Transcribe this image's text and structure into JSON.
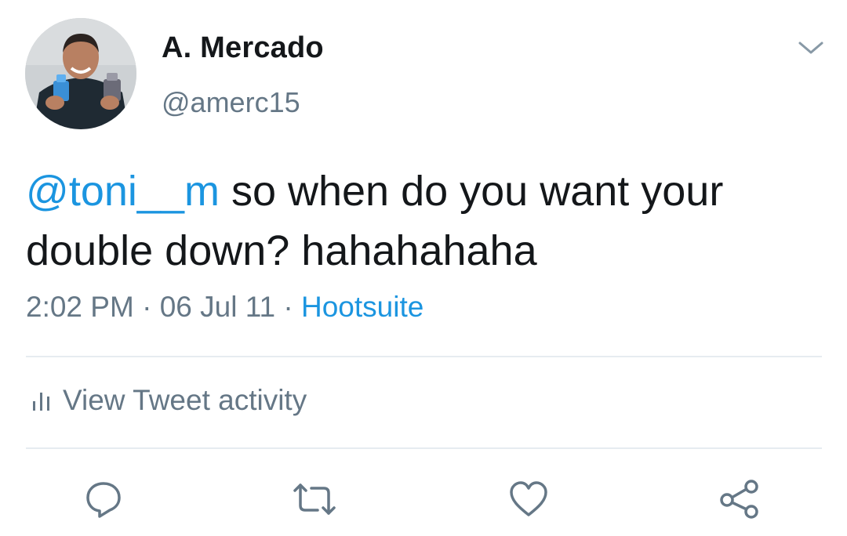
{
  "tweet": {
    "author_name": "A. Mercado",
    "author_handle": "@amerc15",
    "mention": "@toni__m",
    "text": " so when do you want your double down? hahahahaha",
    "time": "2:02 PM",
    "separator": "·",
    "date": "06 Jul 11",
    "source": "Hootsuite"
  },
  "activity": {
    "label": "View Tweet activity"
  },
  "icons": {
    "menu": "chevron-down-icon",
    "activity": "bar-chart-icon",
    "reply": "reply-icon",
    "retweet": "retweet-icon",
    "like": "heart-icon",
    "share": "share-icon"
  },
  "colors": {
    "link": "#1b95e0",
    "secondary": "#657786",
    "primary": "#14171a",
    "divider": "#e6ecf0"
  }
}
